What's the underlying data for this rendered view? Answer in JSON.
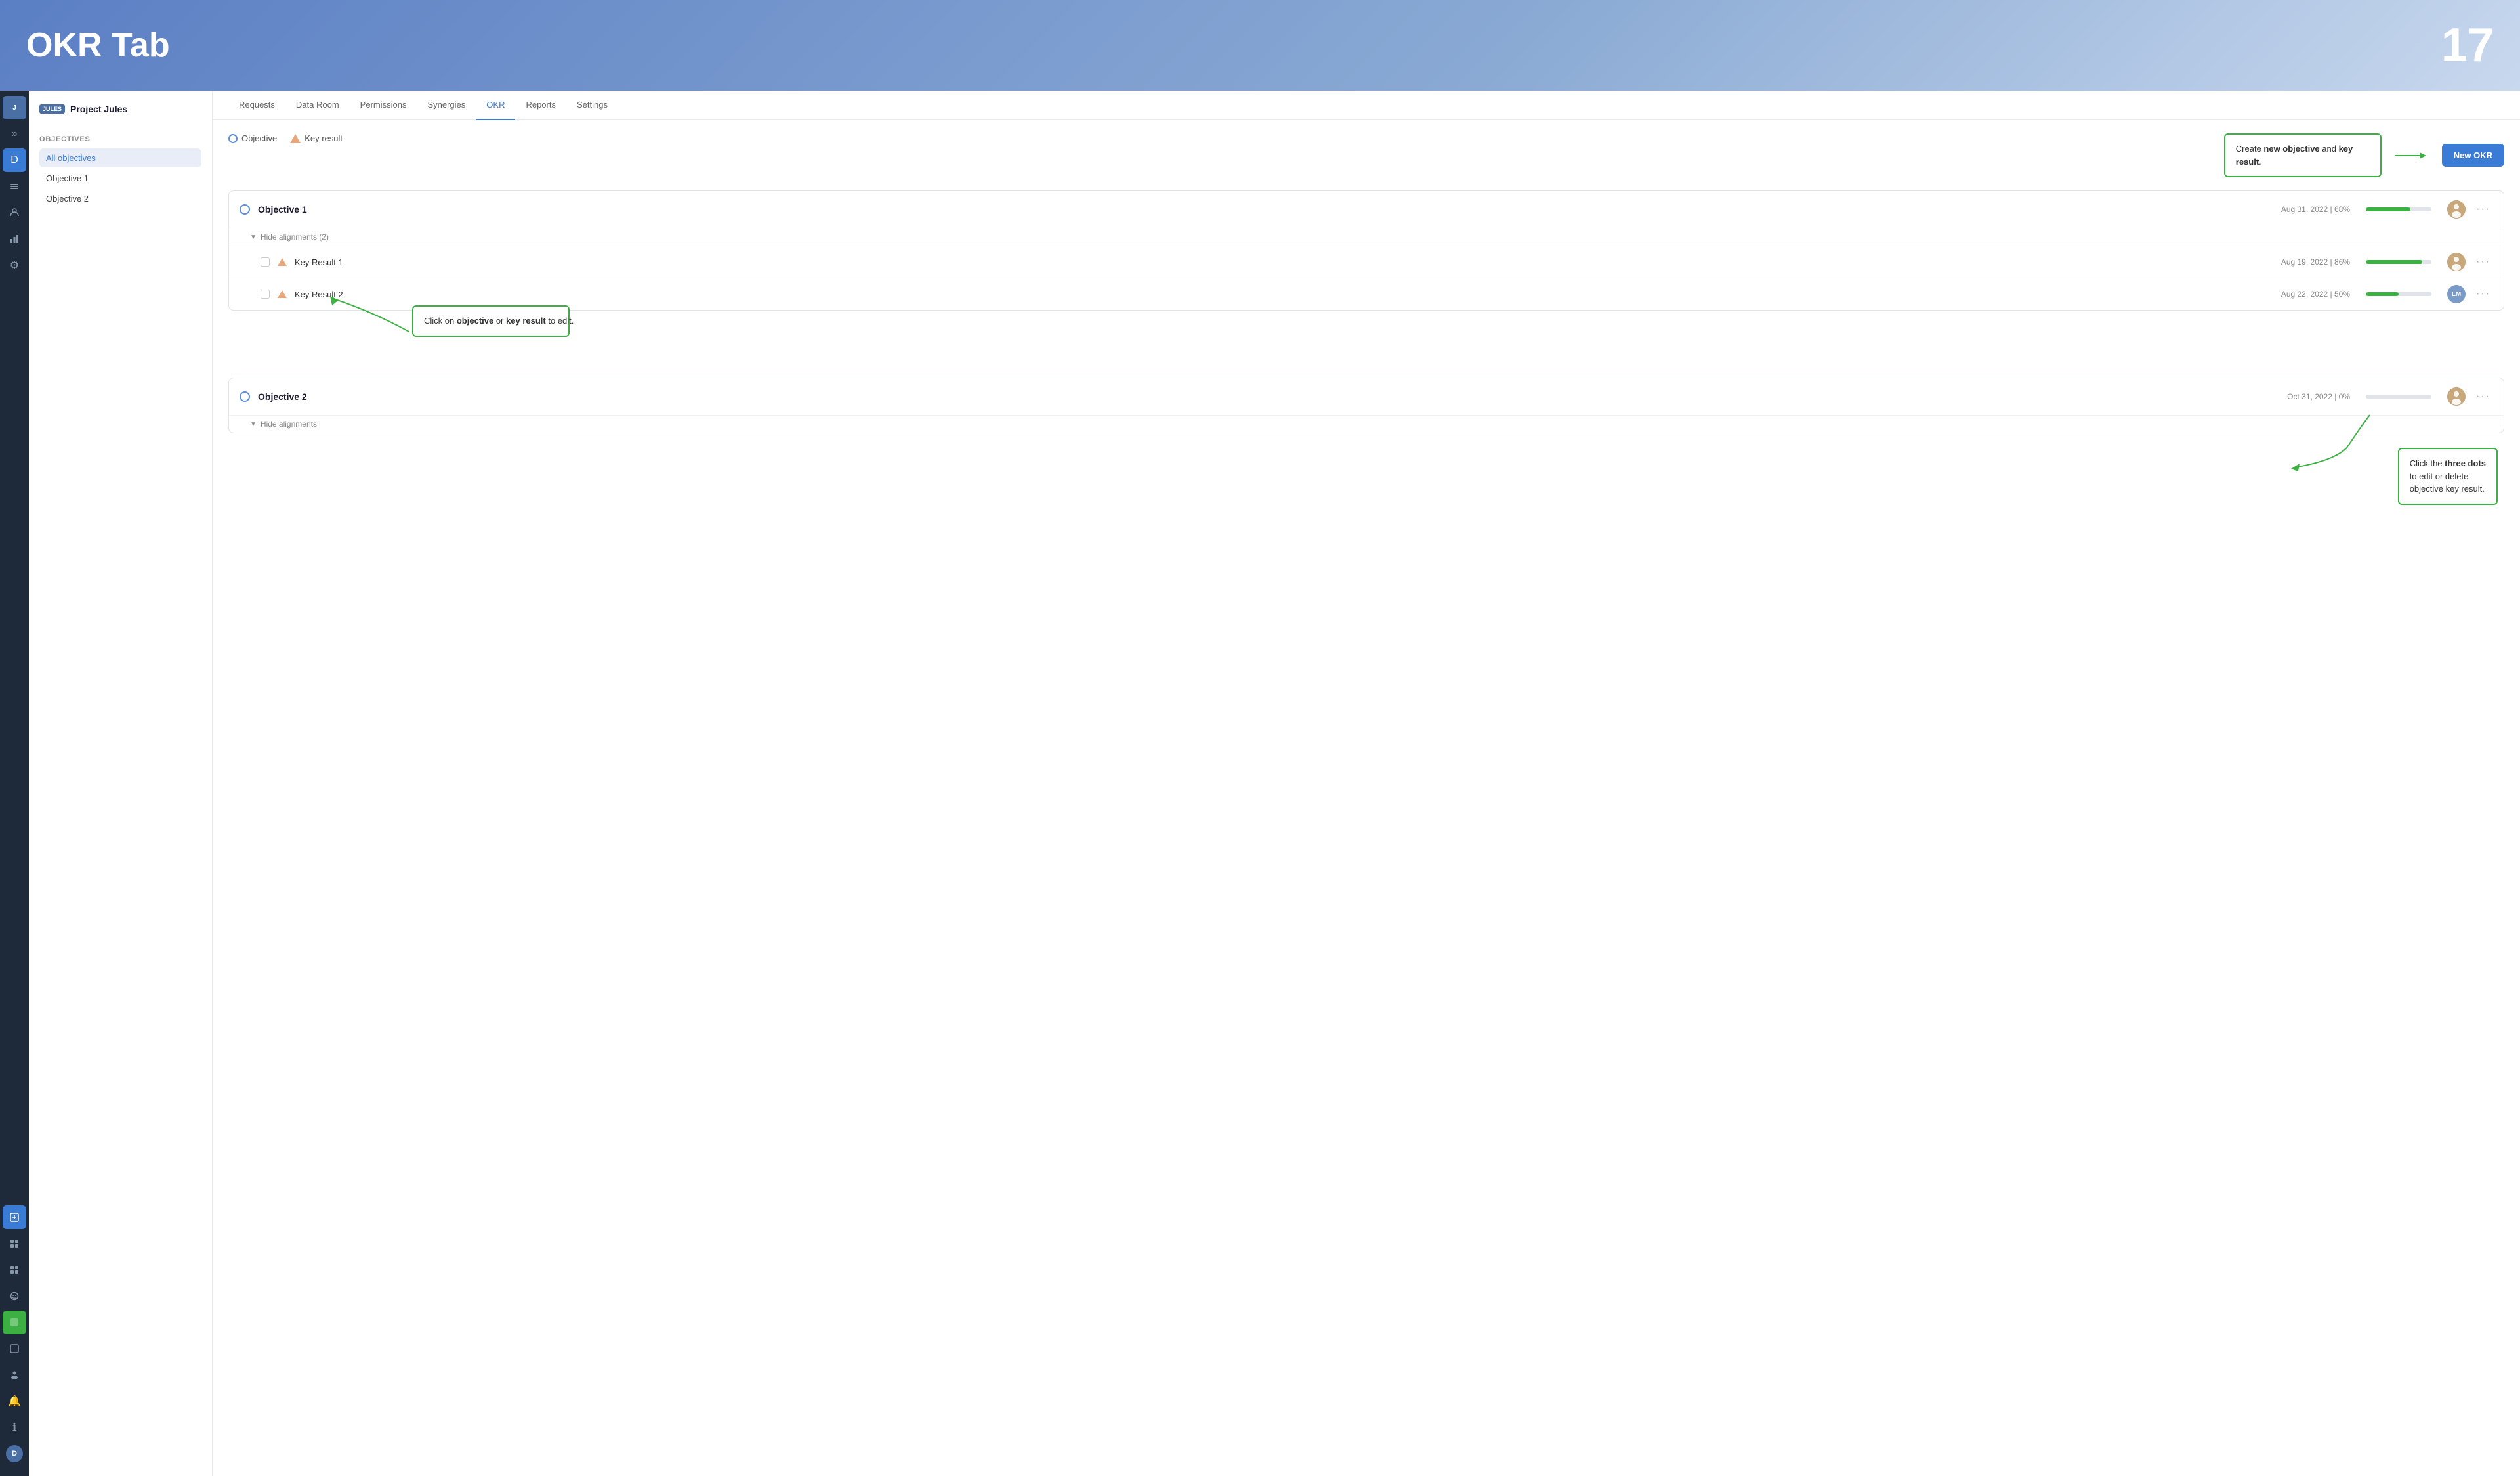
{
  "header": {
    "title": "OKR Tab",
    "number": "17"
  },
  "project": {
    "badge": "JULES",
    "name": "Project Jules"
  },
  "sidebar": {
    "section_label": "OBJECTIVES",
    "items": [
      {
        "label": "All objectives",
        "active": true
      },
      {
        "label": "Objective 1",
        "active": false
      },
      {
        "label": "Objective 2",
        "active": false
      }
    ]
  },
  "nav": {
    "tabs": [
      {
        "label": "Requests",
        "active": false
      },
      {
        "label": "Data Room",
        "active": false
      },
      {
        "label": "Permissions",
        "active": false
      },
      {
        "label": "Synergies",
        "active": false
      },
      {
        "label": "OKR",
        "active": true
      },
      {
        "label": "Reports",
        "active": false
      },
      {
        "label": "Settings",
        "active": false
      }
    ]
  },
  "legend": {
    "objective_label": "Objective",
    "key_result_label": "Key result"
  },
  "callout_create": {
    "text_before": "Create ",
    "bold1": "new objective",
    "text_middle": " and ",
    "bold2": "key result",
    "text_after": "."
  },
  "new_okr_button": "New OKR",
  "callout_click": {
    "text_before": "Click on ",
    "bold1": "objective",
    "text_middle": " or ",
    "bold2": "key result",
    "text_after": " to edit."
  },
  "callout_dots": {
    "text_before": "Click the ",
    "bold1": "three dots",
    "text_middle": "\nto edit or delete\nobjective key result."
  },
  "objectives": [
    {
      "id": 1,
      "name": "Objective 1",
      "date": "Aug 31, 2022",
      "percent": "68%",
      "progress": 68,
      "avatar": "P1",
      "show_alignments": true,
      "alignments_count": 2,
      "key_results": [
        {
          "name": "Key Result 1",
          "date": "Aug 19, 2022",
          "percent": "86%",
          "progress": 86,
          "avatar": "P2"
        },
        {
          "name": "Key Result 2",
          "date": "Aug 22, 2022",
          "percent": "50%",
          "progress": 50,
          "avatar": "LM"
        }
      ]
    },
    {
      "id": 2,
      "name": "Objective 2",
      "date": "Oct 31, 2022",
      "percent": "0%",
      "progress": 0,
      "avatar": "P1",
      "show_alignments": true,
      "alignments_count": 0,
      "key_results": []
    }
  ],
  "colors": {
    "accent": "#3a7bd5",
    "green": "#3cb043",
    "progress_green": "#3cb043"
  },
  "icons": {
    "chevron_double": "»",
    "layers": "▦",
    "users": "👤",
    "chart": "▤",
    "gear": "⚙",
    "home": "⌂",
    "grid": "▣",
    "squares": "⊞",
    "circle_icon": "◉",
    "face": "☺",
    "alert": "🔔",
    "info": "ℹ",
    "user_circle": "👤"
  }
}
